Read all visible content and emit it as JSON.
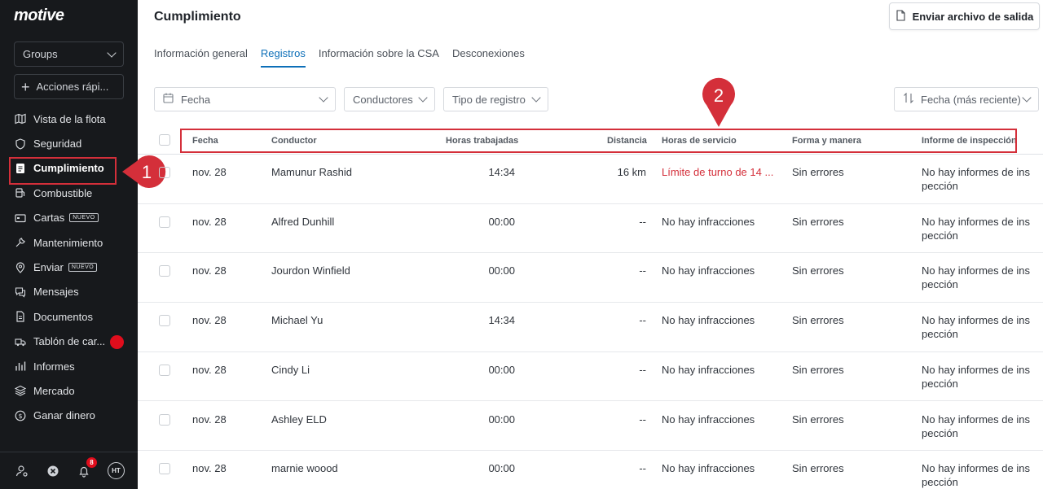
{
  "brand": "motive",
  "sidebar": {
    "groups_label": "Groups",
    "quick_actions_label": "Acciones rápi...",
    "items": [
      {
        "label": "Vista de la flota",
        "icon": "map-icon"
      },
      {
        "label": "Seguridad",
        "icon": "shield-icon"
      },
      {
        "label": "Cumplimiento",
        "icon": "document-icon",
        "active": true
      },
      {
        "label": "Combustible",
        "icon": "fuel-icon"
      },
      {
        "label": "Cartas",
        "icon": "card-icon",
        "badge": "NUEVO"
      },
      {
        "label": "Mantenimiento",
        "icon": "wrench-icon"
      },
      {
        "label": "Enviar",
        "icon": "location-icon",
        "badge": "NUEVO"
      },
      {
        "label": "Mensajes",
        "icon": "chat-icon"
      },
      {
        "label": "Documentos",
        "icon": "file-icon"
      },
      {
        "label": "Tablón de car...",
        "icon": "truck-icon",
        "dot": true
      },
      {
        "label": "Informes",
        "icon": "bars-icon"
      },
      {
        "label": "Mercado",
        "icon": "layers-icon"
      },
      {
        "label": "Ganar dinero",
        "icon": "dollar-icon"
      }
    ],
    "footer": {
      "notifications_count": "8",
      "avatar_initials": "HT"
    }
  },
  "callouts": {
    "one": "1",
    "two": "2",
    "color": "#d42f3a"
  },
  "header": {
    "title": "Cumplimiento",
    "export_label": "Enviar archivo de salida"
  },
  "tabs": [
    {
      "label": "Información general"
    },
    {
      "label": "Registros",
      "active": true
    },
    {
      "label": "Información sobre la CSA"
    },
    {
      "label": "Desconexiones"
    }
  ],
  "filters": {
    "date": "Fecha",
    "drivers": "Conductores",
    "log_type": "Tipo de registro",
    "sort": "Fecha (más reciente)"
  },
  "table": {
    "columns": [
      "Fecha",
      "Conductor",
      "Horas trabajadas",
      "Distancia",
      "Horas de servicio",
      "Forma y manera",
      "Informe de inspección"
    ],
    "rows": [
      {
        "date": "nov. 28",
        "driver": "Mamunur Rashid",
        "hours": "14:34",
        "distance": "16 km",
        "hos": "Límite de turno de 14 ...",
        "hos_violation": true,
        "form": "Sin errores",
        "inspection_1": "No hay informes de ins",
        "inspection_2": "pección"
      },
      {
        "date": "nov. 28",
        "driver": "Alfred Dunhill",
        "hours": "00:00",
        "distance": "--",
        "hos": "No hay infracciones",
        "form": "Sin errores",
        "inspection_1": "No hay informes de ins",
        "inspection_2": "pección"
      },
      {
        "date": "nov. 28",
        "driver": "Jourdon Winfield",
        "hours": "00:00",
        "distance": "--",
        "hos": "No hay infracciones",
        "form": "Sin errores",
        "inspection_1": "No hay informes de ins",
        "inspection_2": "pección"
      },
      {
        "date": "nov. 28",
        "driver": "Michael Yu",
        "hours": "14:34",
        "distance": "--",
        "hos": "No hay infracciones",
        "form": "Sin errores",
        "inspection_1": "No hay informes de ins",
        "inspection_2": "pección"
      },
      {
        "date": "nov. 28",
        "driver": "Cindy Li",
        "hours": "00:00",
        "distance": "--",
        "hos": "No hay infracciones",
        "form": "Sin errores",
        "inspection_1": "No hay informes de ins",
        "inspection_2": "pección"
      },
      {
        "date": "nov. 28",
        "driver": "Ashley ELD",
        "hours": "00:00",
        "distance": "--",
        "hos": "No hay infracciones",
        "form": "Sin errores",
        "inspection_1": "No hay informes de ins",
        "inspection_2": "pección"
      },
      {
        "date": "nov. 28",
        "driver": "marnie woood",
        "hours": "00:00",
        "distance": "--",
        "hos": "No hay infracciones",
        "form": "Sin errores",
        "inspection_1": "No hay informes de ins",
        "inspection_2": "pección"
      }
    ]
  }
}
